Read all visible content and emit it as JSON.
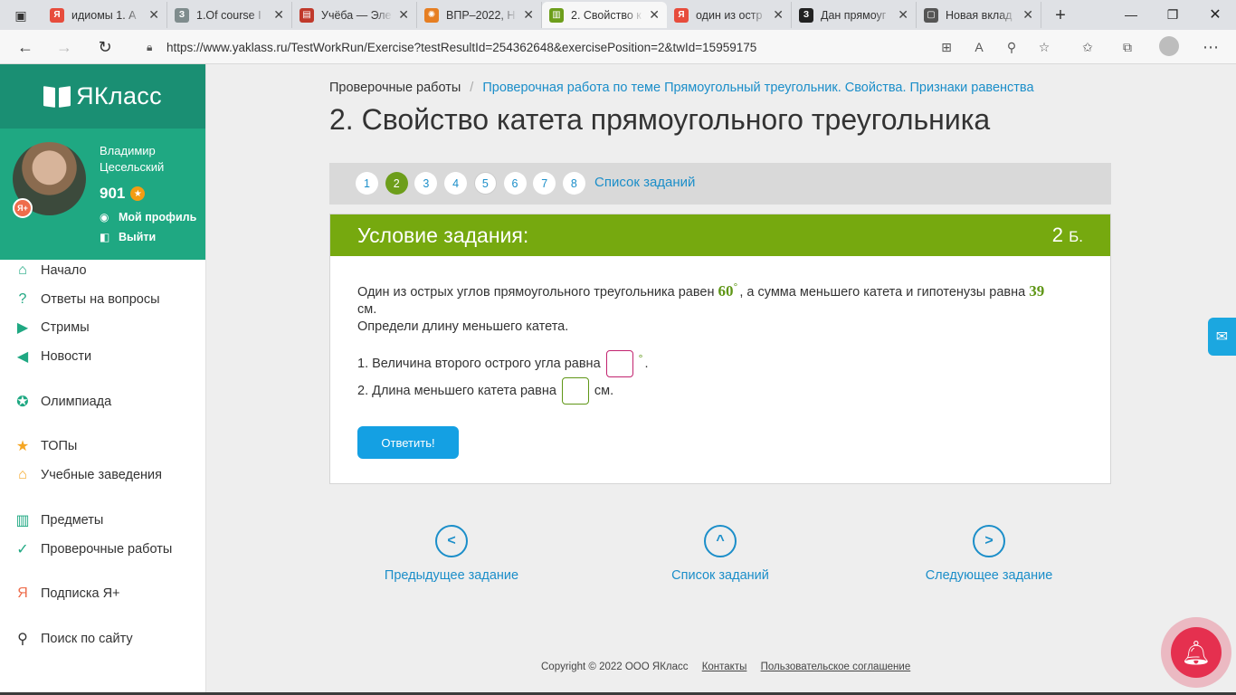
{
  "browser": {
    "tabs": [
      {
        "title": "идиомы 1. А",
        "favicon_color": "#e74c3c",
        "favicon_text": "Я"
      },
      {
        "title": "1.Of course I",
        "favicon_color": "#7f8c8d",
        "favicon_text": "З"
      },
      {
        "title": "Учёба — Эле",
        "favicon_color": "#c0392b",
        "favicon_text": "▤"
      },
      {
        "title": "ВПР–2022, Н",
        "favicon_color": "#e67e22",
        "favicon_text": "✺"
      },
      {
        "title": "2. Свойство к",
        "favicon_color": "#6d9e1b",
        "favicon_text": "▥"
      },
      {
        "title": "один из остр",
        "favicon_color": "#e74c3c",
        "favicon_text": "Я"
      },
      {
        "title": "Дан прямоуг",
        "favicon_color": "#222222",
        "favicon_text": "З"
      },
      {
        "title": "Новая вклад",
        "favicon_color": "#555555",
        "favicon_text": "▢"
      }
    ],
    "active_tab_index": 4,
    "url": "https://www.yaklass.ru/TestWorkRun/Exercise?testResultId=254362648&exercisePosition=2&twId=15959175"
  },
  "sidebar": {
    "logo_text": "ЯКласс",
    "user_name": "Владимир Цесельский",
    "points": "901",
    "badge": "Я+",
    "profile_link": "Мой профиль",
    "logout_link": "Выйти",
    "menu": [
      {
        "label": "Начало",
        "icon": "home-icon",
        "color": "#1fa882"
      },
      {
        "label": "Ответы на вопросы",
        "icon": "question-icon",
        "color": "#1fa882"
      },
      {
        "label": "Стримы",
        "icon": "play-icon",
        "color": "#1fa882"
      },
      {
        "label": "Новости",
        "icon": "megaphone-icon",
        "color": "#1fa882"
      },
      {
        "label": "Олимпиада",
        "icon": "medal-icon",
        "color": "#1fa882"
      },
      {
        "label": "ТОПы",
        "icon": "star-icon",
        "color": "#f5a623"
      },
      {
        "label": "Учебные заведения",
        "icon": "building-icon",
        "color": "#f5a623"
      },
      {
        "label": "Предметы",
        "icon": "books-icon",
        "color": "#1fa882"
      },
      {
        "label": "Проверочные работы",
        "icon": "check-circle-icon",
        "color": "#1fa882"
      },
      {
        "label": "Подписка Я+",
        "icon": "yaplus-icon",
        "color": "#ee6d4c"
      },
      {
        "label": "Поиск по сайту",
        "icon": "search-icon",
        "color": "#333333"
      }
    ]
  },
  "breadcrumb": {
    "root": "Проверочные работы",
    "current": "Проверочная работа по теме Прямоугольный треугольник. Свойства. Признаки равенства"
  },
  "page_title": "2. Свойство катета прямоугольного треугольника",
  "pager": {
    "pages": [
      "1",
      "2",
      "3",
      "4",
      "5",
      "6",
      "7",
      "8"
    ],
    "current": "2",
    "list_label": "Список заданий"
  },
  "task": {
    "header": "Условие задания:",
    "points_value": "2",
    "points_unit": "Б.",
    "text_part1": "Один из острых углов прямоугольного треугольника равен ",
    "angle": "60",
    "text_part2": ", а сумма меньшего катета и гипотенузы равна ",
    "sum": "39",
    "text_part3": " см.",
    "instruction": "Определи длину меньшего катета.",
    "q1_label": "1. Величина второго острого угла равна",
    "q1_value": "",
    "q1_suffix": ".",
    "q2_label": "2. Длина меньшего катета равна",
    "q2_value": "",
    "q2_suffix": "см.",
    "submit_label": "Ответить!"
  },
  "bottom_nav": {
    "prev": "Предыдущее задание",
    "list": "Список заданий",
    "next": "Следующее задание"
  },
  "footer": {
    "copyright": "Copyright © 2022 ООО ЯКласс",
    "contacts": "Контакты",
    "agreement": "Пользовательское соглашение"
  },
  "colors": {
    "brand_green": "#1fa882",
    "task_header": "#76a90f",
    "link_blue": "#1b8ec9",
    "button_blue": "#14a0e3"
  }
}
